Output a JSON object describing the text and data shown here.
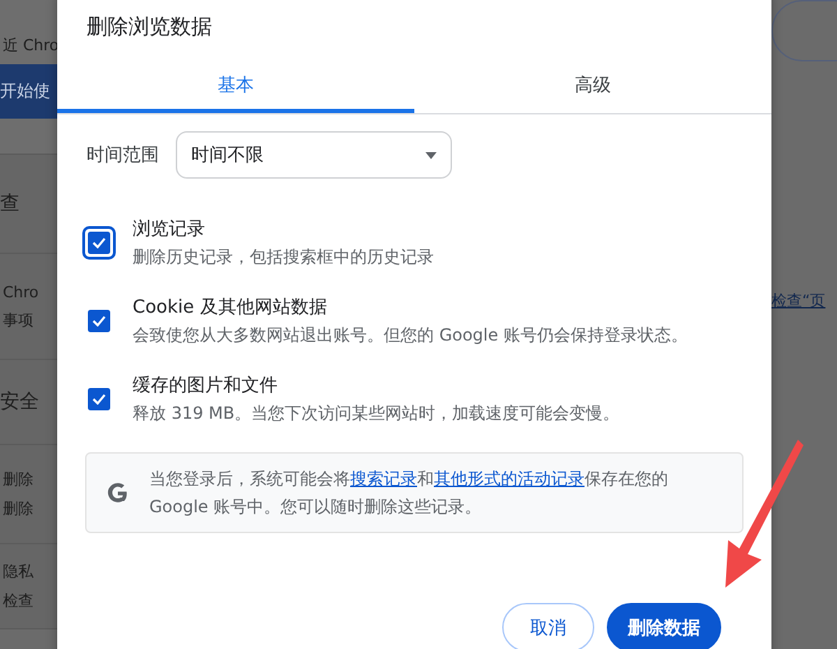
{
  "background": {
    "left_sections": [
      {
        "lines": [
          {
            "kind": "text",
            "text": "近 Chro"
          },
          {
            "kind": "button",
            "text": "开始使"
          }
        ]
      },
      {
        "lines": [
          {
            "kind": "heading",
            "text": "查"
          }
        ]
      },
      {
        "lines": [
          {
            "kind": "text",
            "text": "Chro"
          },
          {
            "kind": "text",
            "text": "事项"
          }
        ]
      },
      {
        "lines": [
          {
            "kind": "heading",
            "text": "安全"
          }
        ]
      },
      {
        "lines": [
          {
            "kind": "text",
            "text": "删除"
          },
          {
            "kind": "text",
            "text": "删除"
          }
        ]
      },
      {
        "lines": [
          {
            "kind": "text",
            "text": "隐私"
          },
          {
            "kind": "text",
            "text": "检查"
          }
        ]
      }
    ],
    "right_link": "检查“页"
  },
  "dialog": {
    "title": "删除浏览数据",
    "tabs": [
      {
        "label": "基本",
        "selected": true
      },
      {
        "label": "高级",
        "selected": false
      }
    ],
    "time_range": {
      "label": "时间范围",
      "value": "时间不限"
    },
    "options": [
      {
        "title": "浏览记录",
        "description": "删除历史记录，包括搜索框中的历史记录",
        "checked": true,
        "focused": true
      },
      {
        "title": "Cookie 及其他网站数据",
        "description": "会致使您从大多数网站退出账号。但您的 Google 账号仍会保持登录状态。",
        "checked": true,
        "focused": false
      },
      {
        "title": "缓存的图片和文件",
        "description": "释放 319 MB。当您下次访问某些网站时，加载速度可能会变慢。",
        "checked": true,
        "focused": false
      }
    ],
    "info": [
      {
        "text": "当您登录后，系统可能会将",
        "link": false
      },
      {
        "text": "搜索记录",
        "link": true
      },
      {
        "text": "和",
        "link": false
      },
      {
        "text": "其他形式的活动记录",
        "link": true
      },
      {
        "text": "保存在您的 Google 账号中。您可以随时删除这些记录。",
        "link": false
      }
    ],
    "buttons": [
      {
        "label": "取消",
        "kind": "secondary"
      },
      {
        "label": "删除数据",
        "kind": "primary"
      }
    ]
  }
}
